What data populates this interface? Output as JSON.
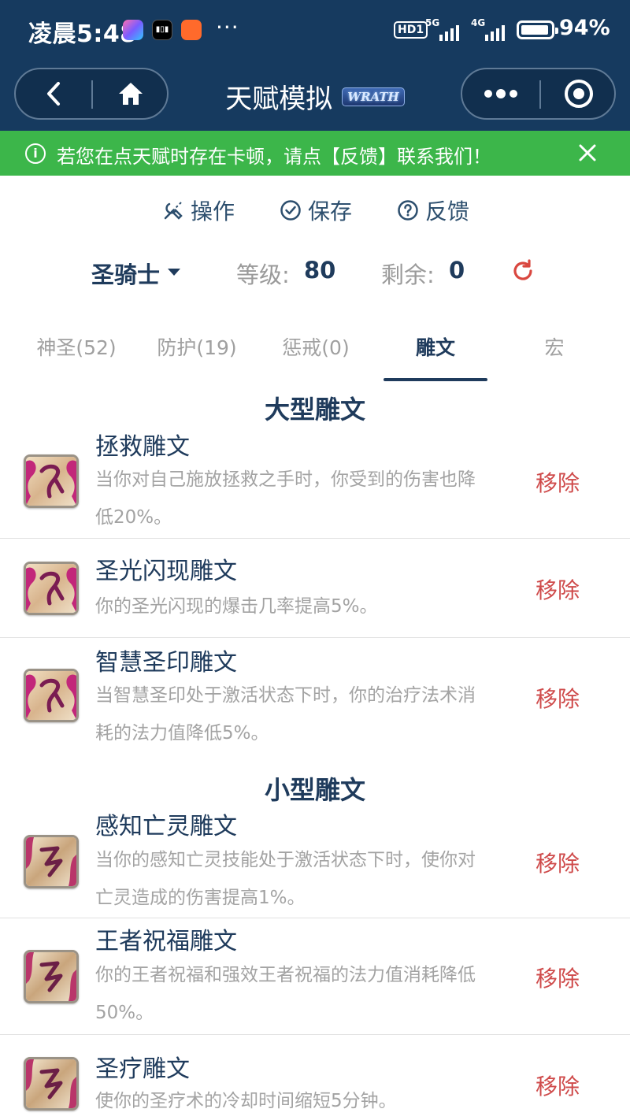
{
  "status_bar": {
    "time": "凌晨5:48",
    "hd": "HD1",
    "net1": "5G",
    "net2": "4G",
    "battery_level": 0.94,
    "battery_text": "94%"
  },
  "nav": {
    "title": "天赋模拟",
    "badge": "WRATH"
  },
  "notice": {
    "text": "若您在点天赋时存在卡顿，请点【反馈】联系我们！"
  },
  "actions": [
    {
      "label": "操作",
      "icon": "wrench-icon"
    },
    {
      "label": "保存",
      "icon": "check-circle-icon"
    },
    {
      "label": "反馈",
      "icon": "question-circle-icon"
    }
  ],
  "class_row": {
    "class_name": "圣骑士",
    "level_label": "等级:",
    "level_value": "80",
    "remaining_label": "剩余:",
    "remaining_value": "0"
  },
  "tabs": [
    {
      "label": "神圣(52)",
      "active": false
    },
    {
      "label": "防护(19)",
      "active": false
    },
    {
      "label": "惩戒(0)",
      "active": false
    },
    {
      "label": "雕文",
      "active": true
    },
    {
      "label": "宏",
      "active": false
    }
  ],
  "major": {
    "title": "大型雕文",
    "glyphs": [
      {
        "name": "拯救雕文",
        "desc_lines": [
          "当你对自己施放拯救之手时，你受到的伤害也降",
          "低20%。"
        ],
        "remove": "移除"
      },
      {
        "name": "圣光闪现雕文",
        "desc_lines": [
          "你的圣光闪现的爆击几率提高5%。"
        ],
        "remove": "移除"
      },
      {
        "name": "智慧圣印雕文",
        "desc_lines": [
          "当智慧圣印处于激活状态下时，你的治疗法术消",
          "耗的法力值降低5%。"
        ],
        "remove": "移除"
      }
    ]
  },
  "minor": {
    "title": "小型雕文",
    "glyphs": [
      {
        "name": "感知亡灵雕文",
        "desc_lines": [
          "当你的感知亡灵技能处于激活状态下时，使你对",
          "亡灵造成的伤害提高1%。"
        ],
        "remove": "移除"
      },
      {
        "name": "王者祝福雕文",
        "desc_lines": [
          "你的王者祝福和强效王者祝福的法力值消耗降低",
          "50%。"
        ],
        "remove": "移除"
      },
      {
        "name": "圣疗雕文",
        "desc_lines": [
          "使你的圣疗术的冷却时间缩短5分钟。"
        ],
        "remove": "移除"
      }
    ]
  },
  "colors": {
    "header_bg": "#163a5f",
    "notice_bg": "#3cb64a",
    "accent": "#1f3b5c",
    "remove": "#cf4b4b"
  }
}
